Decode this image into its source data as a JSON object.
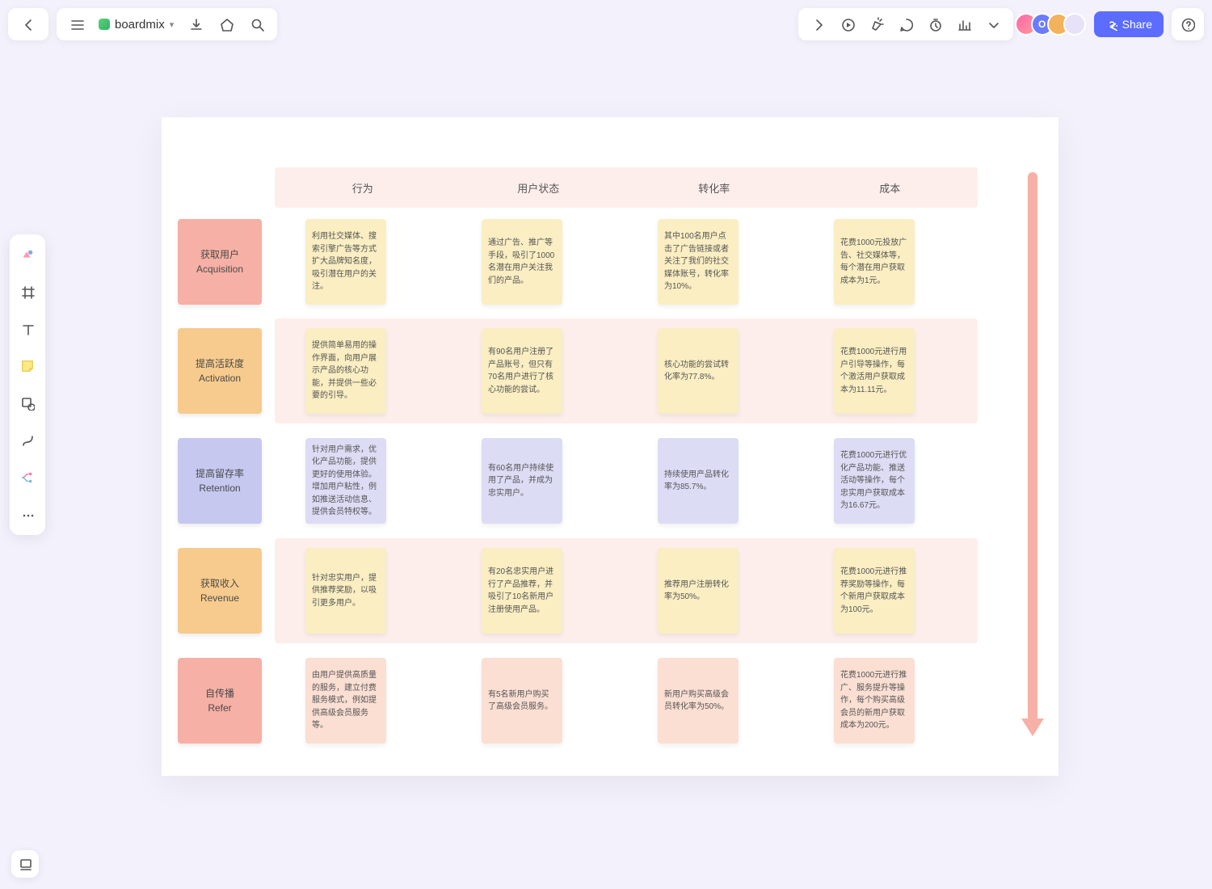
{
  "header": {
    "doc_title": "boardmix",
    "share_label": "Share",
    "avatar_initial": "O"
  },
  "columns": [
    "行为",
    "用户状态",
    "转化率",
    "成本"
  ],
  "rows": [
    {
      "stage_cn": "获取用户",
      "stage_en": "Acquisition",
      "stage_color": "c-pink",
      "note_color": "n-yellow",
      "cells": [
        "利用社交媒体、搜索引擎广告等方式扩大品牌知名度，吸引潜在用户的关注。",
        "通过广告、推广等手段，吸引了1000名潜在用户关注我们的产品。",
        "其中100名用户点击了广告链接或者关注了我们的社交媒体账号，转化率为10%。",
        "花费1000元投放广告、社交媒体等，每个潜在用户获取成本为1元。"
      ]
    },
    {
      "stage_cn": "提高活跃度",
      "stage_en": "Activation",
      "stage_color": "c-orange",
      "note_color": "n-yellow",
      "cells": [
        "提供简单易用的操作界面，向用户展示产品的核心功能，并提供一些必要的引导。",
        "有90名用户注册了产品账号，但只有70名用户进行了核心功能的尝试。",
        "核心功能的尝试转化率为77.8%。",
        "花费1000元进行用户引导等操作，每个激活用户获取成本为11.11元。"
      ]
    },
    {
      "stage_cn": "提高留存率",
      "stage_en": "Retention",
      "stage_color": "c-purple",
      "note_color": "n-purple",
      "cells": [
        "针对用户需求，优化产品功能，提供更好的使用体验。增加用户粘性，例如推送活动信息、提供会员特权等。",
        "有60名用户持续使用了产品，并成为忠实用户。",
        "持续使用产品转化率为85.7%。",
        "花费1000元进行优化产品功能、推送活动等操作，每个忠实用户获取成本为16.67元。"
      ]
    },
    {
      "stage_cn": "获取收入",
      "stage_en": "Revenue",
      "stage_color": "c-orange2",
      "note_color": "n-yellow",
      "cells": [
        "针对忠实用户，提供推荐奖励，以吸引更多用户。",
        "有20名忠实用户进行了产品推荐，并吸引了10名新用户注册使用产品。",
        "推荐用户注册转化率为50%。",
        "花费1000元进行推荐奖励等操作，每个新用户获取成本为100元。"
      ]
    },
    {
      "stage_cn": "自传播",
      "stage_en": "Refer",
      "stage_color": "c-pink2",
      "note_color": "n-pink",
      "cells": [
        "由用户提供高质量的服务，建立付费服务模式，例如提供高级会员服务等。",
        "有5名新用户购买了高级会员服务。",
        "新用户购买高级会员转化率为50%。",
        "花费1000元进行推广、服务提升等操作，每个购买高级会员的新用户获取成本为200元。"
      ]
    }
  ]
}
